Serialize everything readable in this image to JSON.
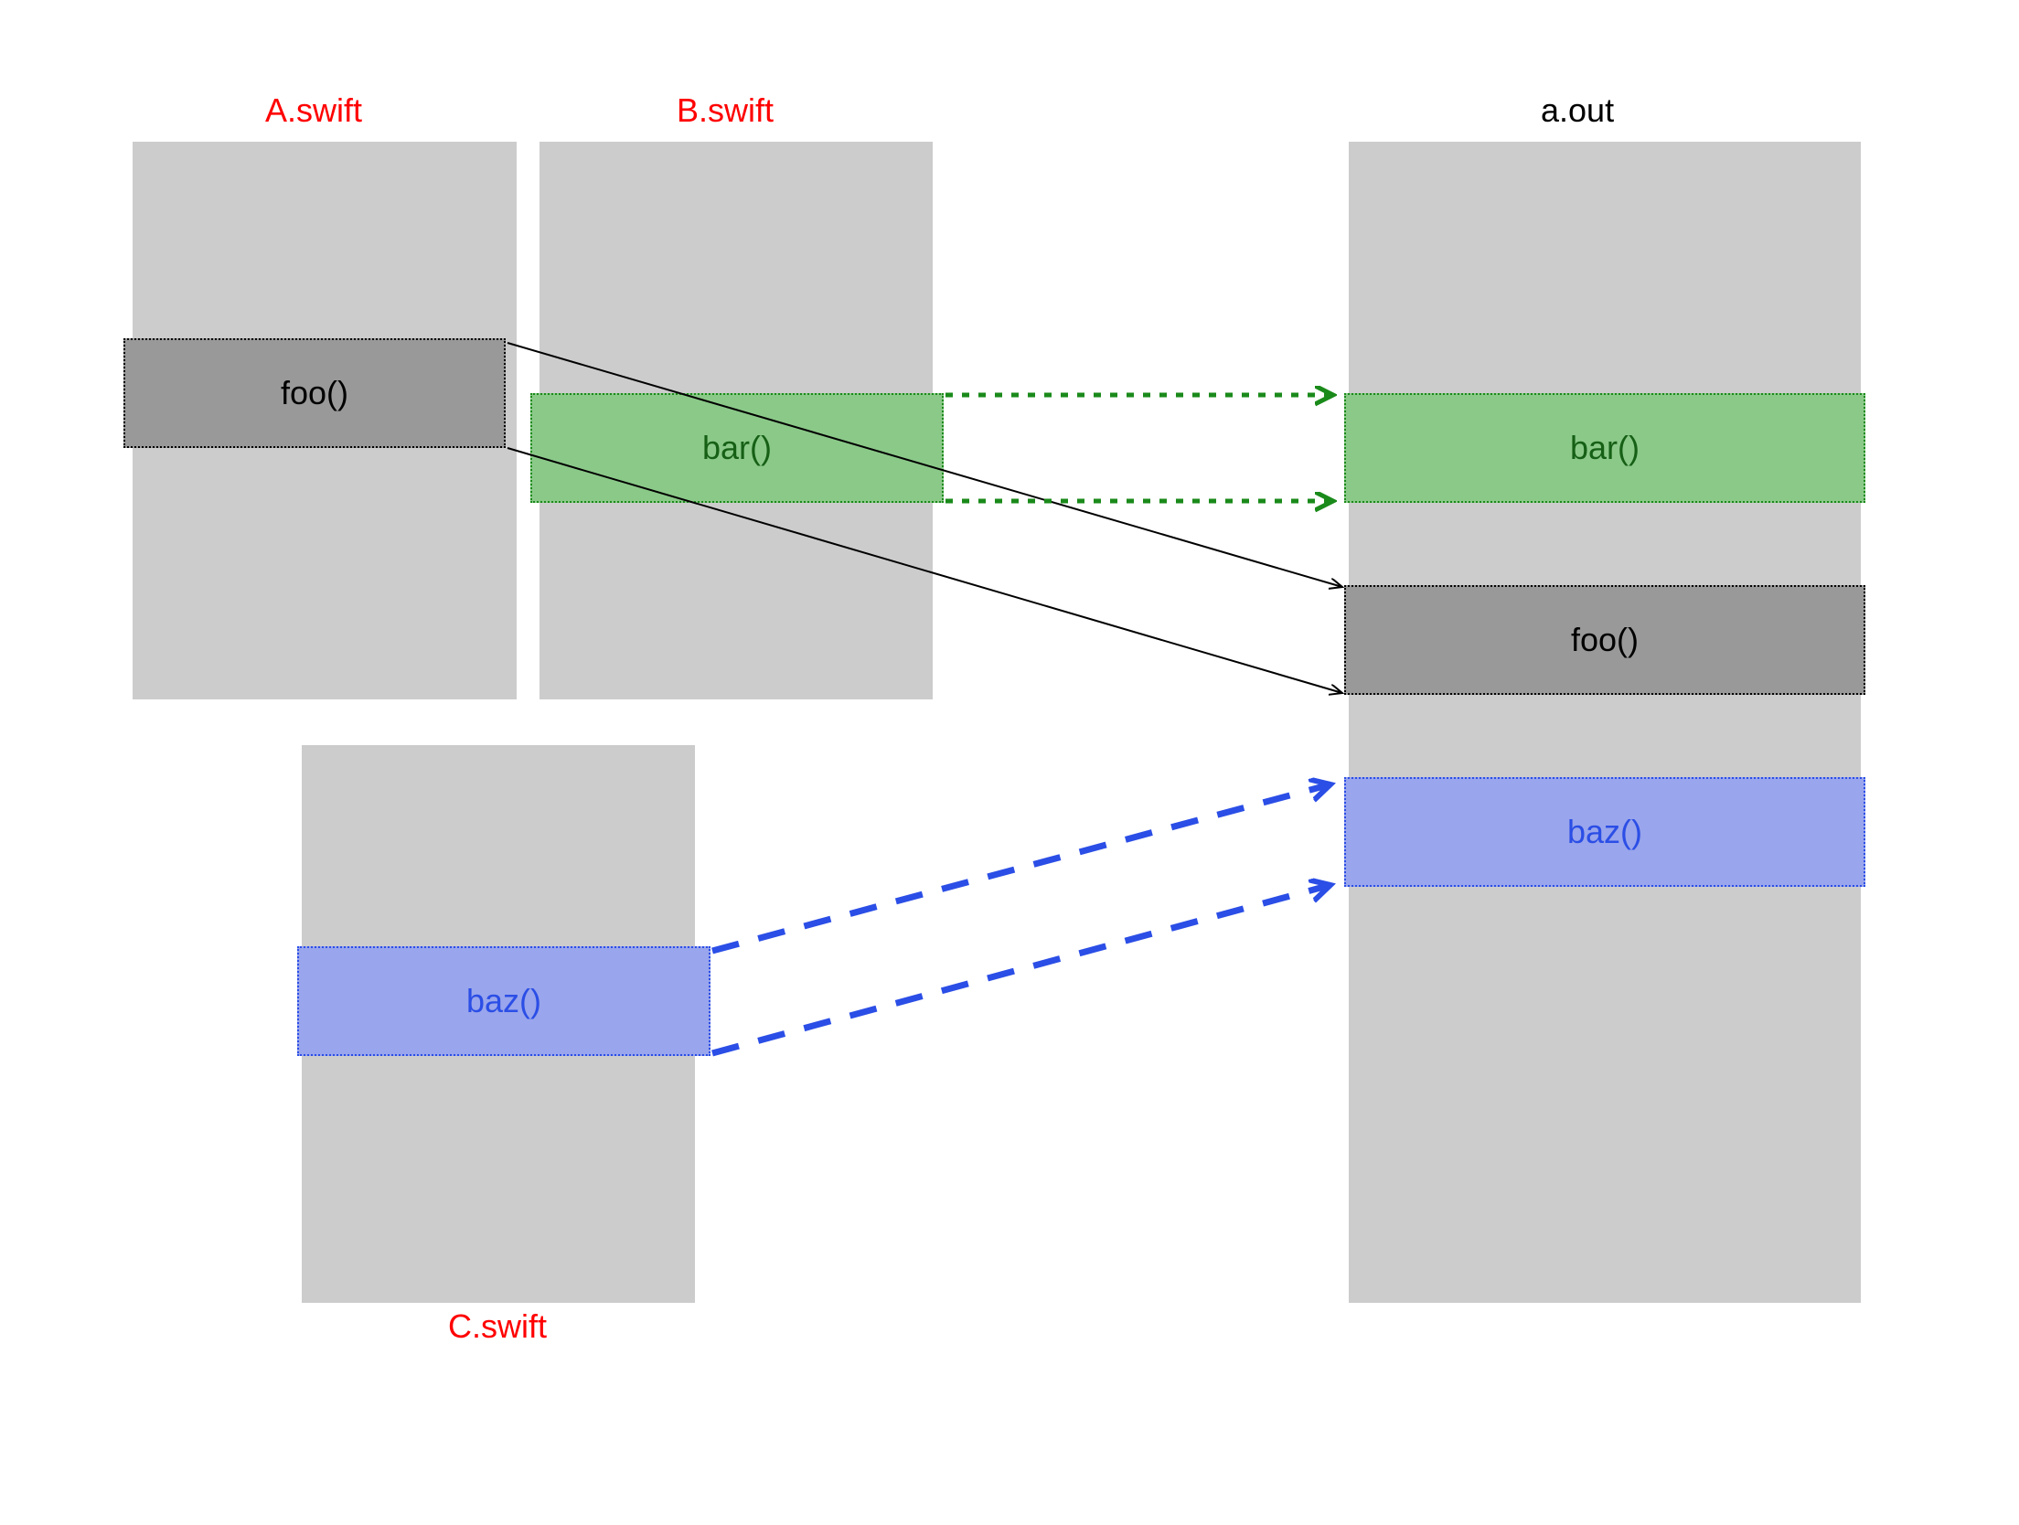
{
  "files": {
    "a": {
      "label": "A.swift"
    },
    "b": {
      "label": "B.swift"
    },
    "c": {
      "label": "C.swift"
    }
  },
  "output": {
    "label": "a.out"
  },
  "functions": {
    "foo_src": "foo()",
    "bar_src": "bar()",
    "baz_src": "baz()",
    "bar_out": "bar()",
    "foo_out": "foo()",
    "baz_out": "baz()"
  },
  "colors": {
    "file_label": "#ff0000",
    "output_label": "#000000",
    "file_bg": "#cccccc",
    "foo_bg": "#999999",
    "bar_bg": "#8bc989",
    "bar_border": "#1a8a1a",
    "baz_bg": "#99a5ec",
    "baz_border": "#2b4ee6"
  }
}
